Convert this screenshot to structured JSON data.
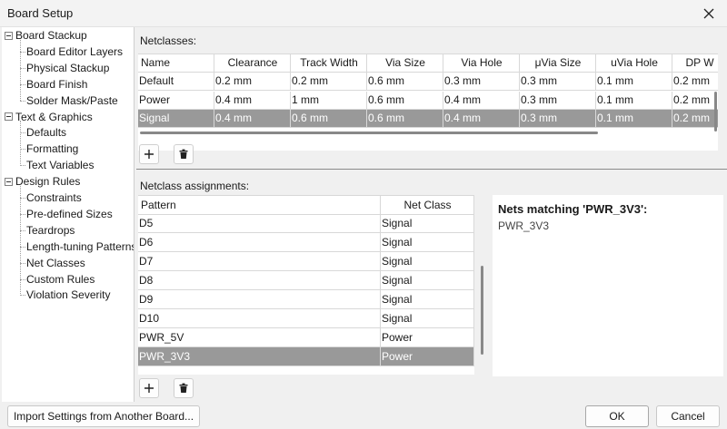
{
  "window": {
    "title": "Board Setup"
  },
  "tree": {
    "groups": [
      {
        "label": "Board Stackup",
        "items": [
          "Board Editor Layers",
          "Physical Stackup",
          "Board Finish",
          "Solder Mask/Paste"
        ]
      },
      {
        "label": "Text & Graphics",
        "items": [
          "Defaults",
          "Formatting",
          "Text Variables"
        ]
      },
      {
        "label": "Design Rules",
        "items": [
          "Constraints",
          "Pre-defined Sizes",
          "Teardrops",
          "Length-tuning Patterns",
          "Net Classes",
          "Custom Rules",
          "Violation Severity"
        ]
      }
    ],
    "selected": "Net Classes"
  },
  "netclasses": {
    "label": "Netclasses:",
    "columns": [
      "Name",
      "Clearance",
      "Track Width",
      "Via Size",
      "Via Hole",
      "μVia Size",
      "uVia Hole",
      "DP W"
    ],
    "rows": [
      [
        "Default",
        "0.2 mm",
        "0.2 mm",
        "0.6 mm",
        "0.3 mm",
        "0.3 mm",
        "0.1 mm",
        "0.2 mm"
      ],
      [
        "Power",
        "0.4 mm",
        "1 mm",
        "0.6 mm",
        "0.4 mm",
        "0.3 mm",
        "0.1 mm",
        "0.2 mm"
      ],
      [
        "Signal",
        "0.4 mm",
        "0.6 mm",
        "0.6 mm",
        "0.4 mm",
        "0.3 mm",
        "0.1 mm",
        "0.2 mm"
      ]
    ],
    "selected_row": 2
  },
  "assignments": {
    "label": "Netclass assignments:",
    "columns": [
      "Pattern",
      "Net Class"
    ],
    "rows": [
      [
        "D5",
        "Signal"
      ],
      [
        "D6",
        "Signal"
      ],
      [
        "D7",
        "Signal"
      ],
      [
        "D8",
        "Signal"
      ],
      [
        "D9",
        "Signal"
      ],
      [
        "D10",
        "Signal"
      ],
      [
        "PWR_5V",
        "Power"
      ],
      [
        "PWR_3V3",
        "Power"
      ]
    ],
    "selected_row": 7
  },
  "matches": {
    "heading": "Nets matching 'PWR_3V3':",
    "items": [
      "PWR_3V3"
    ]
  },
  "footer": {
    "import_label": "Import Settings from Another Board...",
    "ok_label": "OK",
    "cancel_label": "Cancel"
  },
  "icons": {
    "close": "close-icon",
    "add": "plus-icon",
    "delete": "trash-icon"
  },
  "colors": {
    "selection": "#999999"
  }
}
